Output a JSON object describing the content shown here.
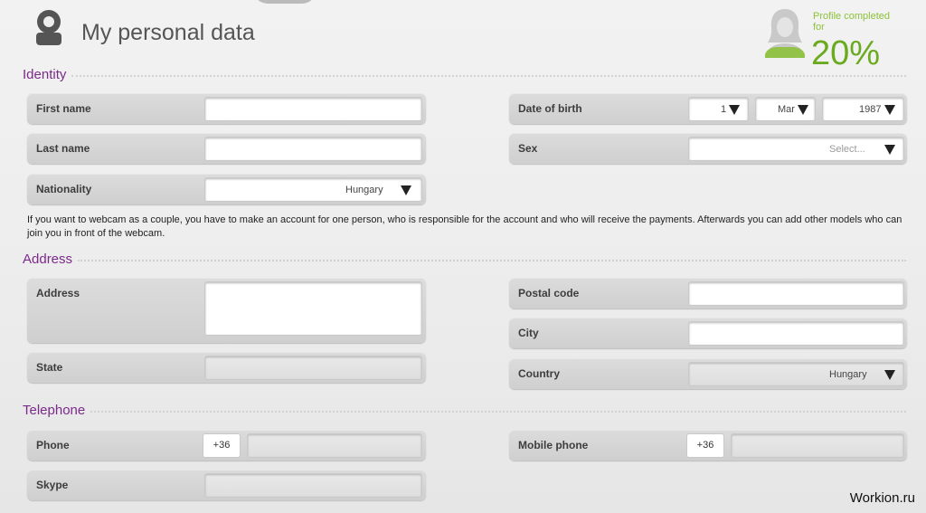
{
  "header": {
    "title": "My personal data",
    "profile_caption_line1": "Profile completed",
    "profile_caption_line2": "for",
    "profile_percent_text": "20%",
    "profile_completion": 0.2
  },
  "sections": {
    "identity": "Identity",
    "address": "Address",
    "telephone": "Telephone"
  },
  "identity": {
    "first_name_label": "First name",
    "first_name_value": "",
    "last_name_label": "Last name",
    "last_name_value": "",
    "nationality_label": "Nationality",
    "nationality_value": "Hungary",
    "dob_label": "Date of birth",
    "dob_day": "1",
    "dob_month": "Mar",
    "dob_year": "1987",
    "sex_label": "Sex",
    "sex_placeholder": "Select..."
  },
  "info_text": "If you want to webcam as a couple, you have to make an account for one person, who is responsible for the account and who will receive the payments. Afterwards you can add other models who can join you in front of the webcam.",
  "address": {
    "address_label": "Address",
    "state_label": "State",
    "postal_code_label": "Postal code",
    "city_label": "City",
    "country_label": "Country",
    "country_value": "Hungary"
  },
  "telephone": {
    "phone_label": "Phone",
    "phone_prefix": "+36",
    "mobile_label": "Mobile phone",
    "mobile_prefix": "+36",
    "skype_label": "Skype"
  },
  "watermark": "Workion.ru",
  "colors": {
    "accent_purple": "#7b2a8a",
    "progress_green": "#6aaa1e"
  }
}
